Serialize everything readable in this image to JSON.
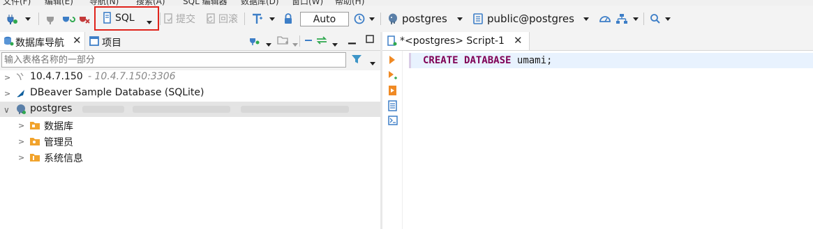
{
  "menu": {
    "items": [
      "文件(F)",
      "编辑(E)",
      "导航(N)",
      "搜索(A)",
      "SQL 编辑器",
      "数据库(D)",
      "窗口(W)",
      "帮助(H)"
    ]
  },
  "toolbar": {
    "sql_label": "SQL",
    "commit_label": "提交",
    "rollback_label": "回滚",
    "transaction_mode": "Auto",
    "datasource": "postgres",
    "schema": "public@postgres"
  },
  "navigator": {
    "tab_label": "数据库导航",
    "projects_tab_label": "项目",
    "filter_placeholder": "输入表格名称的一部分",
    "tree": [
      {
        "label": "10.4.7.150",
        "detail": "- 10.4.7.150:3306",
        "icon": "mysql-connection-icon"
      },
      {
        "label": "DBeaver Sample Database (SQLite)",
        "icon": "sqlite-icon"
      },
      {
        "label": "postgres",
        "icon": "postgres-icon",
        "selected": true
      },
      {
        "label": "数据库",
        "icon": "folder-icon"
      },
      {
        "label": "管理员",
        "icon": "folder-icon"
      },
      {
        "label": "系统信息",
        "icon": "folder-icon"
      }
    ]
  },
  "editor": {
    "tab_label": "*<postgres> Script-1",
    "code": {
      "kw1": "CREATE",
      "kw2": "DATABASE",
      "name": "umami",
      "end": ";"
    }
  },
  "colors": {
    "highlight_border": "#e0231b",
    "keyword": "#7f0055",
    "current_line": "#e8f2fe"
  }
}
